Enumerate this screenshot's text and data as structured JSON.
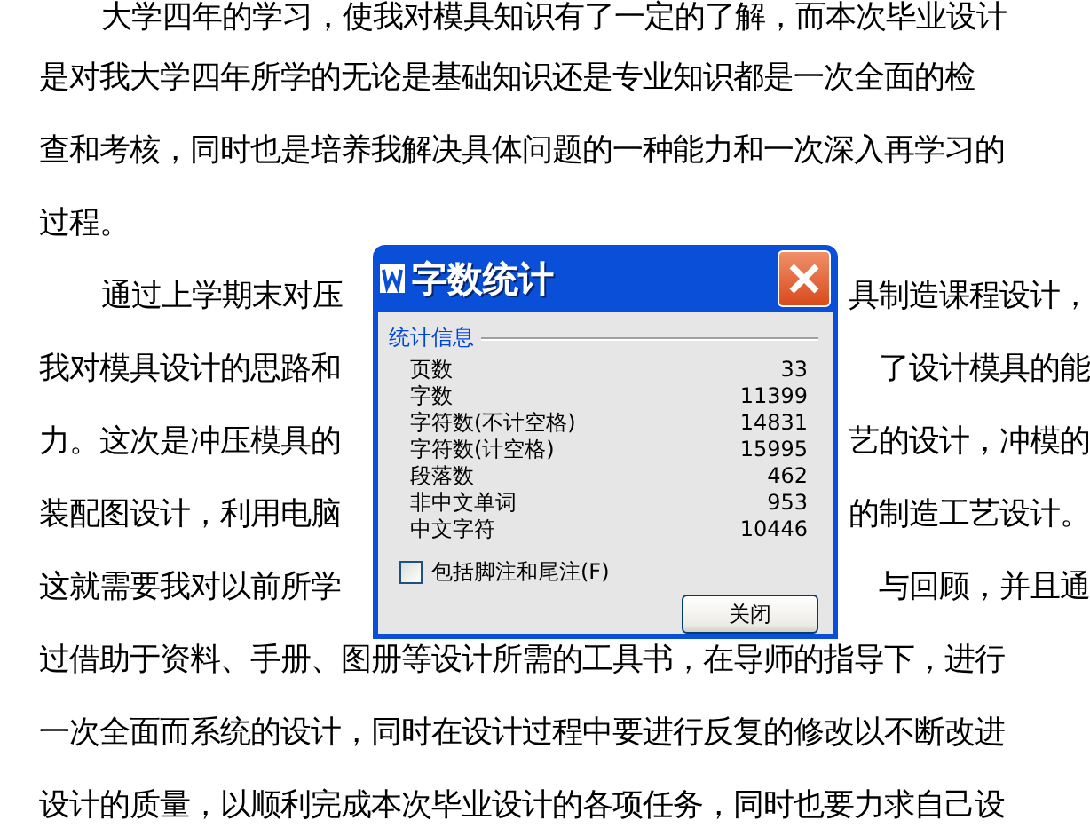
{
  "document": {
    "lines": [
      {
        "indent": true,
        "segments": [
          "大学四年的学习，使我对模具知识有了一定的了解，而本次毕业设计"
        ]
      },
      {
        "indent": false,
        "segments": [
          "是对我大学四年所学的无论是基础知识还是专业知识都是一次全面的检"
        ]
      },
      {
        "indent": false,
        "segments": [
          "查和考核，同时也是培养我解决具体问题的一种能力和一次深入再学习的"
        ]
      },
      {
        "indent": false,
        "segments": [
          "过程。"
        ]
      },
      {
        "indent": true,
        "segments": [
          "通过上学期末对压",
          "具制造课程设计，"
        ]
      },
      {
        "indent": false,
        "segments": [
          "我对模具设计的思路和",
          "了设计模具的能"
        ]
      },
      {
        "indent": false,
        "segments": [
          "力。这次是冲压模具的",
          "艺的设计，冲模的"
        ]
      },
      {
        "indent": false,
        "segments": [
          "装配图设计，利用电脑",
          "的制造工艺设计。"
        ]
      },
      {
        "indent": false,
        "segments": [
          "这就需要我对以前所学",
          "与回顾，并且通"
        ]
      },
      {
        "indent": false,
        "segments": [
          "过借助于资料、手册、图册等设计所需的工具书，在导师的指导下，进行"
        ]
      },
      {
        "indent": false,
        "segments": [
          "一次全面而系统的设计，同时在设计过程中要进行反复的修改以不断改进"
        ]
      },
      {
        "indent": false,
        "segments": [
          "设计的质量，以顺利完成本次毕业设计的各项任务，同时也要力求自己设"
        ]
      }
    ]
  },
  "dialog": {
    "title": "字数统计",
    "group_label": "统计信息",
    "stats": [
      {
        "label": "页数",
        "value": "33"
      },
      {
        "label": "字数",
        "value": "11399"
      },
      {
        "label": "字符数(不计空格)",
        "value": "14831"
      },
      {
        "label": "字符数(计空格)",
        "value": "15995"
      },
      {
        "label": "段落数",
        "value": "462"
      },
      {
        "label": "非中文单词",
        "value": "953"
      },
      {
        "label": "中文字符",
        "value": "10446"
      }
    ],
    "checkbox": {
      "label": "包括脚注和尾注(F)",
      "checked": false
    },
    "button": "关闭"
  }
}
